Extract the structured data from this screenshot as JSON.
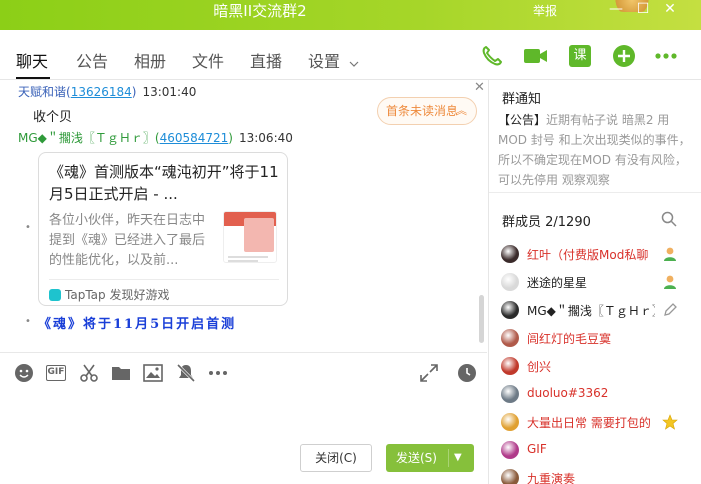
{
  "window": {
    "title": "暗黑II交流群2",
    "report_label": "举报",
    "minimize_glyph": "—",
    "maximize_glyph": "☐",
    "close_glyph": "✕"
  },
  "tabs": [
    {
      "label": "聊天"
    },
    {
      "label": "公告"
    },
    {
      "label": "相册"
    },
    {
      "label": "文件"
    },
    {
      "label": "直播"
    },
    {
      "label": "设置"
    }
  ],
  "tab_icons": [
    "phone-icon",
    "video-icon",
    "lesson-icon",
    "add-icon",
    "more-icon"
  ],
  "lesson_glyph": "课",
  "chat": {
    "messages": [
      {
        "sender": "天赋和谐",
        "uid": "13626184",
        "time": "13:01:40",
        "text": "收个贝"
      },
      {
        "sender": "MG◆＂擱浅〖ＴｇＨｒ〗",
        "uid": "460584721",
        "time": "13:06:40"
      }
    ],
    "card": {
      "title": "《魂》首测版本“魂沌初开”将于11月5日正式开启 - ...",
      "description": "各位小伙伴，昨天在日志中提到《魂》已经进入了最后的性能优化，以及前...",
      "source": "TapTap 发现好游戏"
    },
    "caption": "《魂》将于11月5日开启首测",
    "unread_label": "首条未读消息",
    "unread_arrow": "︽",
    "close_glyph": "✕"
  },
  "input_tools": [
    "emoji-icon",
    "gif-icon",
    "scissors-icon",
    "folder-icon",
    "image-icon",
    "mute-icon",
    "more-icon",
    "expand-icon",
    "history-icon"
  ],
  "gif_label": "GIF",
  "buttons": {
    "close_label": "关闭(C)",
    "send_label": "发送(S)",
    "dropdown_glyph": "▼"
  },
  "notice": {
    "title": "群通知",
    "tag": "【公告】",
    "text": "近期有帖子说 暗黑2 用MOD 封号 和上次出现类似的事件， 所以不确定现在MOD 有没有风险， 可以先停用 观察观察"
  },
  "members": {
    "header": "群成员 2/1290",
    "list": [
      {
        "name": "红叶（付费版Mod私聊",
        "color": "#d8312a",
        "badge": "person-green"
      },
      {
        "name": "迷途的星星",
        "color": "#222222",
        "badge": "person-green"
      },
      {
        "name": "MG◆＂擱浅〖ＴｇＨｒ〗",
        "color": "#222222",
        "badge": "pencil"
      },
      {
        "name": "闾红灯的毛豆寞",
        "color": "#d8312a",
        "badge": ""
      },
      {
        "name": "创兴",
        "color": "#d8312a",
        "badge": ""
      },
      {
        "name": "duoluo#3362",
        "color": "#d8312a",
        "badge": ""
      },
      {
        "name": "大量出日常 需要打包的",
        "color": "#d8312a",
        "badge": "star"
      },
      {
        "name": "GIF",
        "color": "#d8312a",
        "badge": ""
      },
      {
        "name": "九重演奏",
        "color": "#d8312a",
        "badge": ""
      }
    ]
  },
  "colors": {
    "accent_green": "#7cc21f",
    "send_green": "#86c03b",
    "member_red": "#d8312a",
    "uid_blue": "#1e8dd8"
  }
}
